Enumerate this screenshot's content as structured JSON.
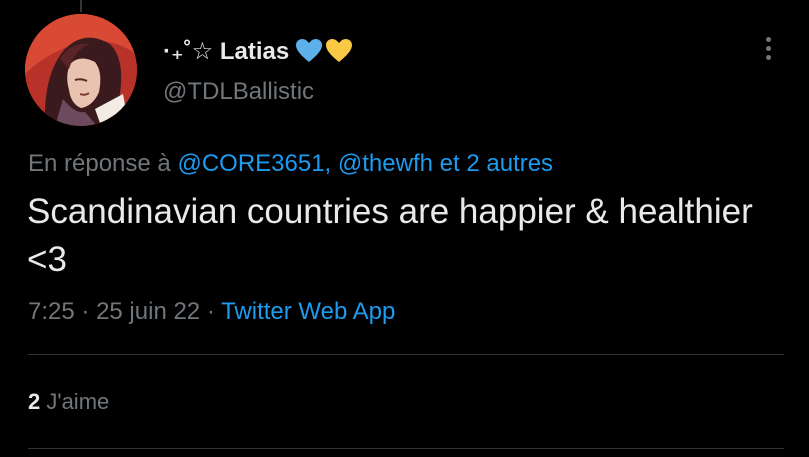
{
  "author": {
    "display_name": "·₊˚☆ Latias",
    "handle": "@TDLBallistic",
    "avatar_icon": "character-portrait-avatar",
    "name_emojis": [
      "blue-heart-icon",
      "yellow-heart-icon"
    ]
  },
  "reply": {
    "prefix": "En réponse à",
    "mention_1": "@CORE3651,",
    "mention_2": "@thewfh",
    "joiner": "et",
    "others": "2 autres"
  },
  "tweet": {
    "text": "Scandinavian countries are happier & healthier <3",
    "time": "7:25",
    "separator": "·",
    "date": "25 juin 22",
    "source": "Twitter Web App"
  },
  "stats": {
    "likes_count": "2",
    "likes_label": "J'aime"
  },
  "colors": {
    "background": "#000000",
    "text": "#e7e9ea",
    "secondary": "#71767b",
    "link": "#1d9bf0",
    "divider": "#2f3336",
    "blue_heart": "#5eb0ea",
    "yellow_heart": "#f9c945"
  }
}
